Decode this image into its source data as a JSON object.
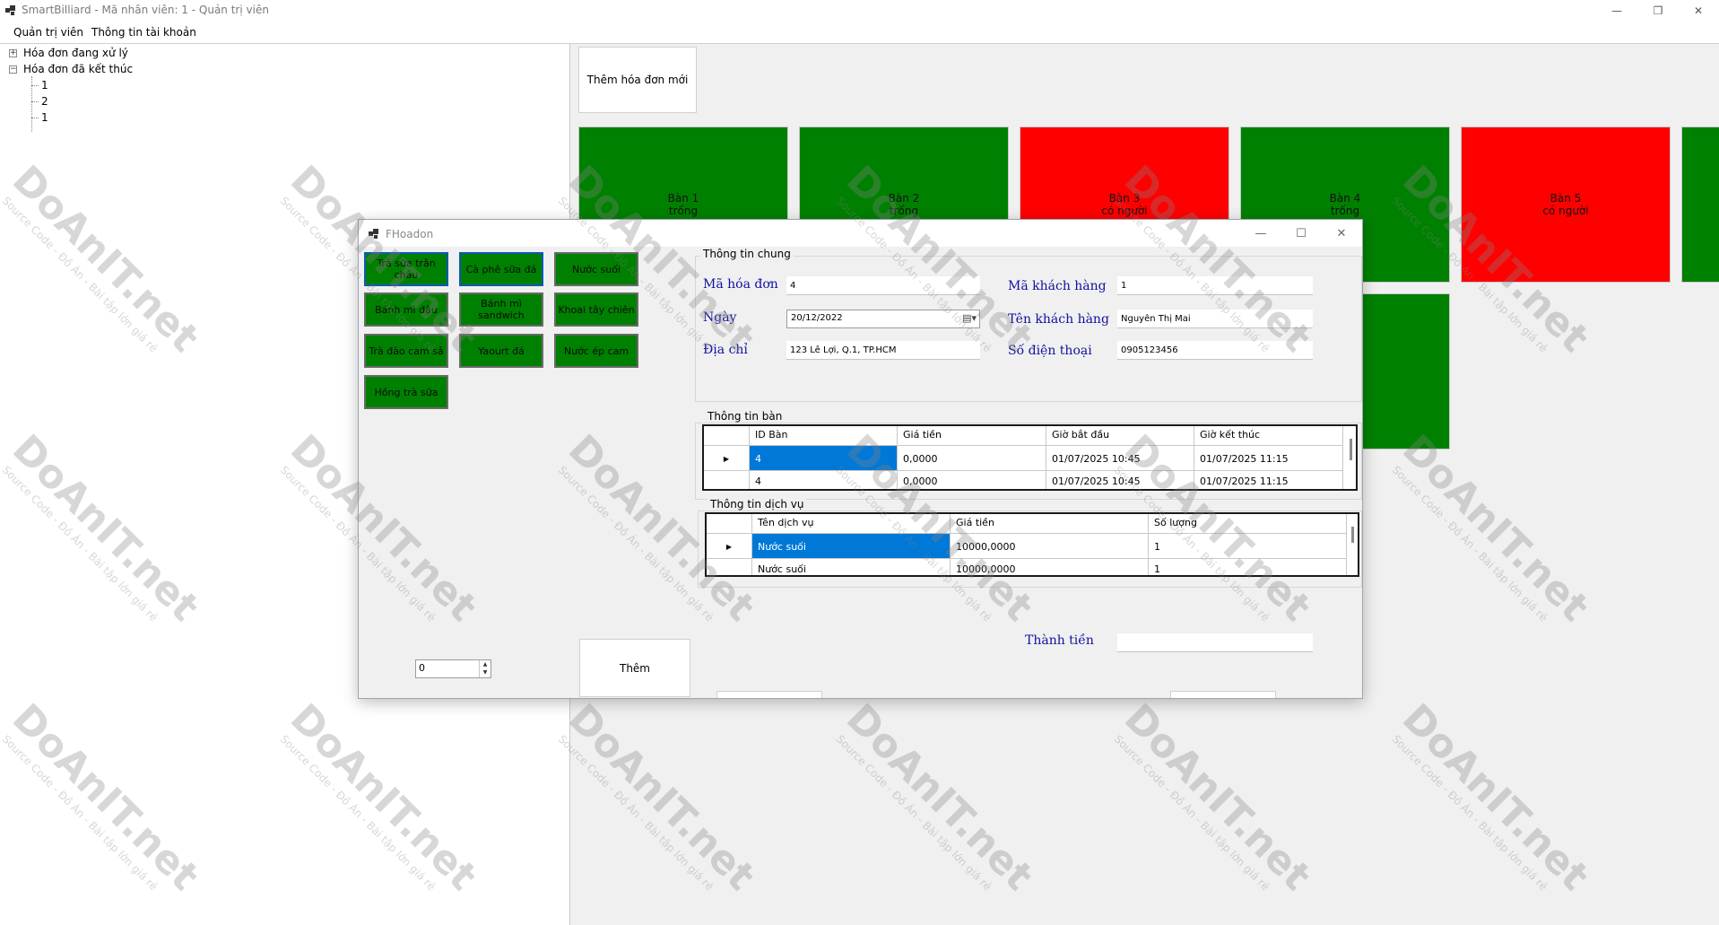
{
  "window": {
    "title": "SmartBilliard - Mã nhân viên: 1 - Quản trị viên",
    "minimize_icon": "minimize-icon",
    "maximize_icon": "restore-icon",
    "close_icon": "close-icon"
  },
  "menu": {
    "items": [
      "Quản trị viên",
      "Thông tin tài khoản"
    ]
  },
  "tree": {
    "processing_label": "Hóa đơn đang xử lý",
    "finished_label": "Hóa đơn đã kết thúc",
    "finished_children": [
      "1",
      "2",
      "1"
    ]
  },
  "main": {
    "new_invoice_label": "Thêm hóa đơn mới",
    "tables": [
      {
        "name": "Bàn 1",
        "status": "trống",
        "color": "#008000"
      },
      {
        "name": "Bàn 2",
        "status": "trống",
        "color": "#008000"
      },
      {
        "name": "Bàn 3",
        "status": "có người",
        "color": "#ff0000"
      },
      {
        "name": "Bàn 4",
        "status": "trống",
        "color": "#008000"
      },
      {
        "name": "Bàn 5",
        "status": "có người",
        "color": "#ff0000"
      }
    ]
  },
  "dialog": {
    "title": "FHoadon",
    "services": [
      "Trà sữa trân châu",
      "Cà phê sữa đá",
      "Nước suối",
      "Bánh mì đậu",
      "Bánh mì sandwich",
      "Khoai tây chiên",
      "Trà đào cam sả",
      "Yaourt đá",
      "Nước ép cam",
      "Hồng trà sữa"
    ],
    "general": {
      "group_title": "Thông tin chung",
      "invoice_id_label": "Mã hóa đơn",
      "invoice_id_value": "4",
      "date_label": "Ngày",
      "date_value": "20/12/2022",
      "address_label": "Địa chỉ",
      "address_value": "123 Lê Lợi, Q.1, TP.HCM",
      "customer_id_label": "Mã khách hàng",
      "customer_id_value": "1",
      "customer_name_label": "Tên khách hàng",
      "customer_name_value": "Nguyễn Thị Mai",
      "phone_label": "Số điện thoại",
      "phone_value": "0905123456"
    },
    "tables_info": {
      "group_title": "Thông tin bàn",
      "columns": [
        "ID Bàn",
        "Giá tiền",
        "Giờ bắt đầu",
        "Giờ kết thúc"
      ],
      "rows": [
        [
          "4",
          "0,0000",
          "01/07/2025 10:45",
          "01/07/2025 11:15"
        ],
        [
          "4",
          "0,0000",
          "01/07/2025 10:45",
          "01/07/2025 11:15"
        ]
      ]
    },
    "services_info": {
      "group_title": "Thông tin dịch vụ",
      "columns": [
        "Tên dịch vụ",
        "Giá tiền",
        "Số lượng"
      ],
      "rows": [
        [
          "Nước suối",
          "10000,0000",
          "1"
        ],
        [
          "Nước suối",
          "10000,0000",
          "1"
        ]
      ]
    },
    "total_label": "Thành tiền",
    "total_value": "",
    "add_button": "Thêm",
    "quantity_value": "0"
  },
  "watermark": {
    "logo": "DoAnIT.net",
    "sub": "Source Code - Đồ Án - Bài tập lớn giá rẻ"
  },
  "colors": {
    "tile_green": "#008000",
    "tile_red": "#ff0000",
    "selection_blue": "#0078d7",
    "label_blue": "#1010a0"
  }
}
